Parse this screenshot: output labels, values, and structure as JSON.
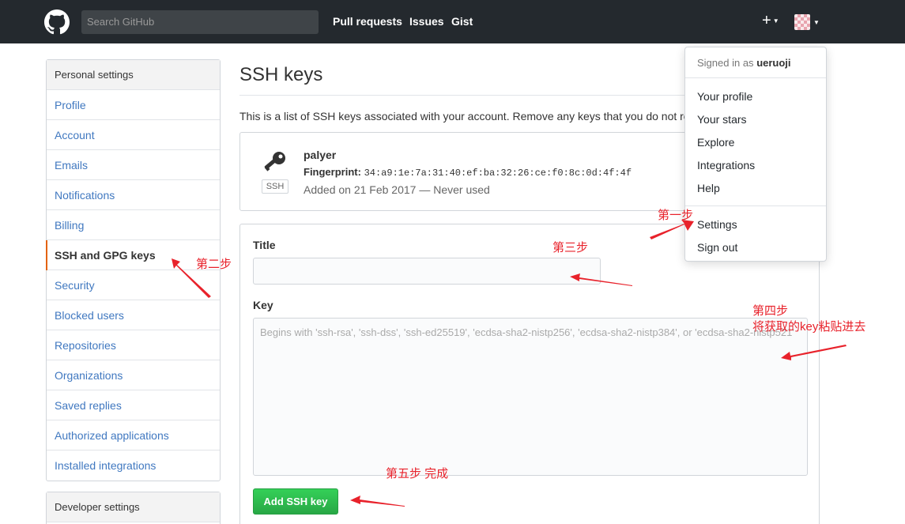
{
  "header": {
    "search_placeholder": "Search GitHub",
    "nav": [
      "Pull requests",
      "Issues",
      "Gist"
    ],
    "plus_label": "+"
  },
  "sidebar": {
    "heading": "Personal settings",
    "items": [
      {
        "label": "Profile"
      },
      {
        "label": "Account"
      },
      {
        "label": "Emails"
      },
      {
        "label": "Notifications"
      },
      {
        "label": "Billing"
      },
      {
        "label": "SSH and GPG keys",
        "selected": true
      },
      {
        "label": "Security"
      },
      {
        "label": "Blocked users"
      },
      {
        "label": "Repositories"
      },
      {
        "label": "Organizations"
      },
      {
        "label": "Saved replies"
      },
      {
        "label": "Authorized applications"
      },
      {
        "label": "Installed integrations"
      }
    ],
    "developer_heading": "Developer settings"
  },
  "main": {
    "title": "SSH keys",
    "intro": "This is a list of SSH keys associated with your account. Remove any keys that you do not rec",
    "key": {
      "name": "palyer",
      "fingerprint_label": "Fingerprint:",
      "fingerprint": "34:a9:1e:7a:31:40:ef:ba:32:26:ce:f0:8c:0d:4f:4f",
      "added": "Added on 21 Feb 2017 — Never used",
      "badge": "SSH"
    },
    "form": {
      "title_label": "Title",
      "key_label": "Key",
      "key_placeholder": "Begins with 'ssh-rsa', 'ssh-dss', 'ssh-ed25519', 'ecdsa-sha2-nistp256', 'ecdsa-sha2-nistp384', or 'ecdsa-sha2-nistp521'",
      "submit": "Add SSH key"
    }
  },
  "dropdown": {
    "signed_prefix": "Signed in as",
    "username": "ueruoji",
    "items": [
      "Your profile",
      "Your stars",
      "Explore",
      "Integrations",
      "Help"
    ],
    "settings": "Settings",
    "signout": "Sign out"
  },
  "annotations": {
    "step1": "第一步",
    "step2": "第二步",
    "step3": "第三步",
    "step4_a": "第四步",
    "step4_b": "将获取的key粘贴进去",
    "step5": "第五步   完成"
  },
  "colors": {
    "header": "#24292e",
    "link": "#4078c0",
    "selected_bar": "#e36209",
    "button": "#28a745",
    "annotation": "#e8222b"
  }
}
